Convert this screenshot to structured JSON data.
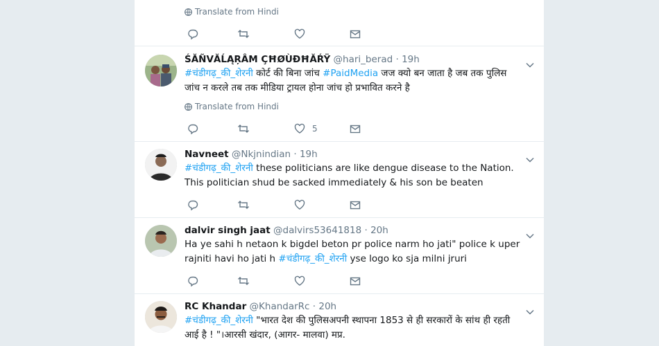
{
  "top_tweet": {
    "translate_label": "Translate from Hindi"
  },
  "tweets": [
    {
      "fullname": "ŚĂÑVĂĹĄŖÂM ÇĦØÙĐĦĂŔŸ",
      "handle": "@hari_berad",
      "dot": "·",
      "time": "19h",
      "text_parts": [
        "#चंडीगढ़_की_शेरनी",
        " कोर्ट की बिना जांच ",
        "#PaidMedia",
        " जज क्यो बन जाता है जब तक पुलिस जांच न करले तब तक मीडिया ट्रायल होना जांच हो प्रभावित करने है"
      ],
      "translate_label": "Translate from Hindi",
      "like_count": "5"
    },
    {
      "fullname": "Navneet",
      "handle": "@Nkjnindian",
      "dot": "·",
      "time": "19h",
      "text_parts": [
        "#चंडीगढ़_की_शेरनी",
        " these politicians are like dengue disease to the Nation. This politician shud be sacked immediately & his son be beaten"
      ]
    },
    {
      "fullname": "dalvir singh jaat",
      "handle": "@dalvirs53641818",
      "dot": "·",
      "time": "20h",
      "text_parts": [
        "Ha ye sahi h netaon k bigdel beton pr police narm ho jati\" police k uper rajniti havi ho jati h ",
        "#चंडीगढ़_की_शेरनी",
        " yse logo ko sja milni jruri"
      ]
    },
    {
      "fullname": "RC Khandar",
      "handle": "@KhandarRc",
      "dot": "·",
      "time": "20h",
      "text_parts": [
        "#चंडीगढ़_की_शेरनी",
        " \"भारत देश की पुलिसअपनी स्थापना 1853 से ही सरकारों के सांथ ही रहती आई है ! \"।आरसी खंदार, (आगर- मालवा) मप्र."
      ]
    }
  ],
  "colors": {
    "hashtag": "#1da1f2",
    "meta": "#657786",
    "background": "#e6ecf0"
  },
  "icons": [
    "globe-icon",
    "reply-icon",
    "retweet-icon",
    "like-icon",
    "message-icon",
    "chevron-down-icon"
  ]
}
